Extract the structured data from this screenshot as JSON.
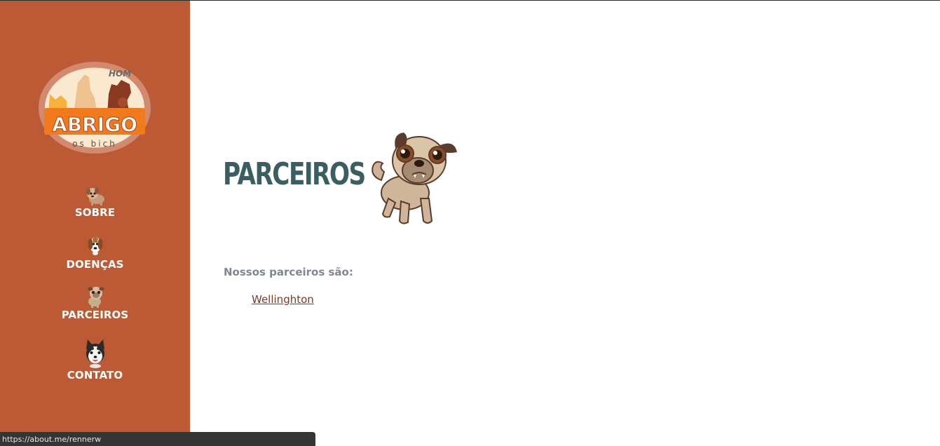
{
  "sidebar": {
    "logo": {
      "text": "ABRIGO",
      "top_text": "HOM",
      "bottom_text": "os bich"
    },
    "nav": [
      {
        "label": "SOBRE",
        "icon": "puppy-icon"
      },
      {
        "label": "DOENÇAS",
        "icon": "beagle-icon"
      },
      {
        "label": "PARCEIROS",
        "icon": "pug-icon"
      },
      {
        "label": "CONTATO",
        "icon": "husky-icon"
      }
    ]
  },
  "main": {
    "title": "PARCEIROS",
    "title_icon": "pug-icon",
    "intro": "Nossos parceiros são:",
    "partners": [
      {
        "name": "Wellinghton"
      }
    ]
  },
  "status_bar": {
    "url": "https://about.me/rennerw"
  },
  "colors": {
    "sidebar_bg": "#bb5a35",
    "title": "#3b5e63",
    "intro_text": "#7f8790",
    "link": "#7a3a22",
    "status_bar_bg": "#353535"
  }
}
